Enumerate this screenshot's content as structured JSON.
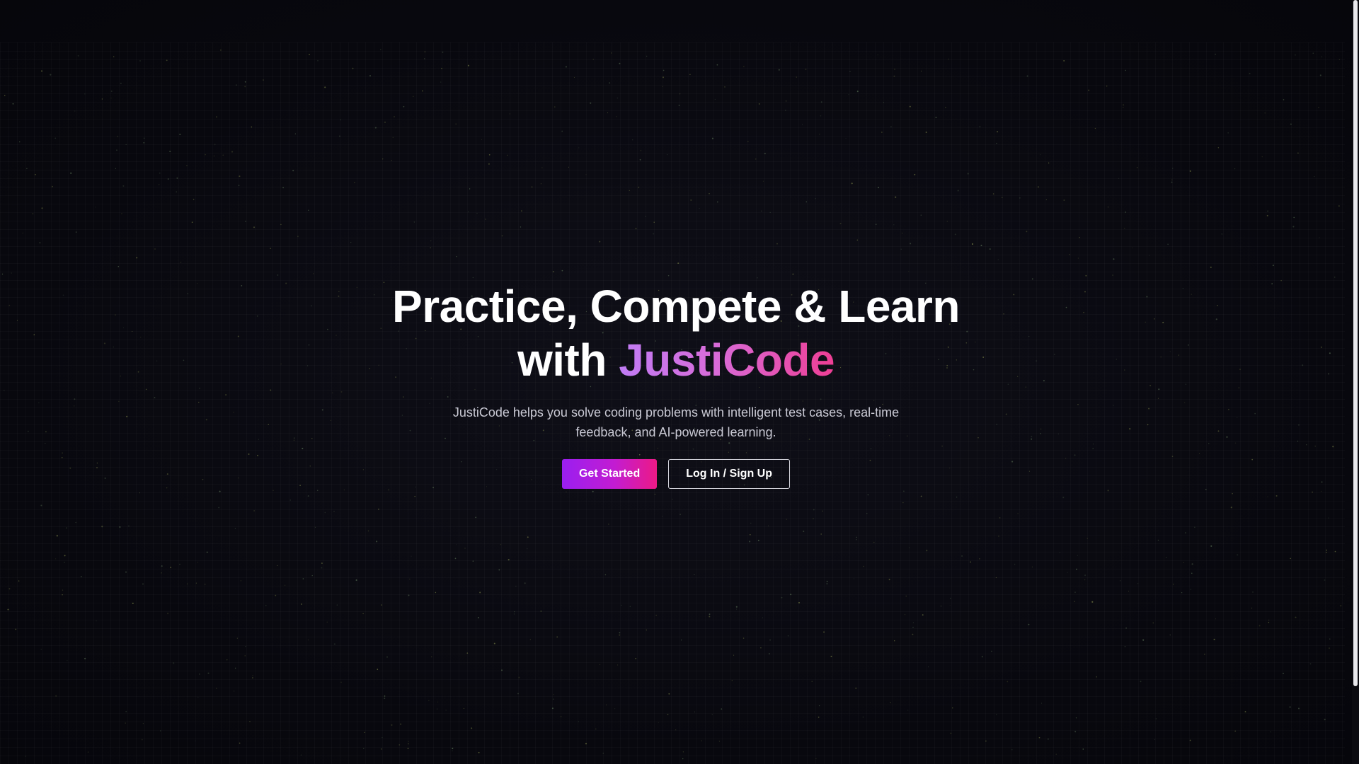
{
  "hero": {
    "headline_line1": "Practice, Compete & Learn",
    "headline_with": "with ",
    "brand_name": "JustiCode",
    "subtitle": "JustiCode helps you solve coding problems with intelligent test cases, real-time feedback, and AI-powered learning."
  },
  "actions": {
    "primary_label": "Get Started",
    "secondary_label": "Log In / Sign Up"
  },
  "colors": {
    "background": "#07070d",
    "brand_gradient_start": "#c07cf5",
    "brand_gradient_end": "#ee3e94",
    "button_gradient_start": "#9a1ff0",
    "button_gradient_end": "#ec1a86"
  }
}
